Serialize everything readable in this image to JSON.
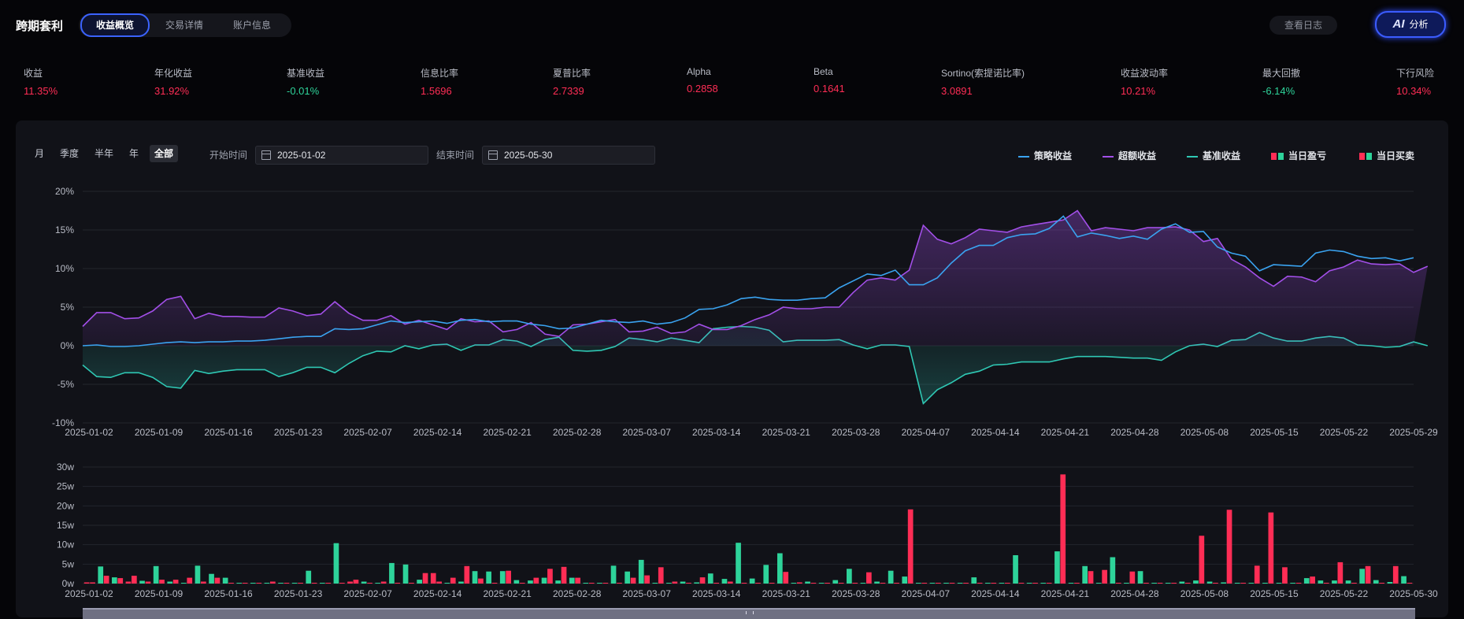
{
  "header": {
    "app_title": "跨期套利",
    "tabs": [
      "收益概览",
      "交易详情",
      "账户信息"
    ],
    "active_tab": 0,
    "log_button": "查看日志",
    "ai_button": {
      "mark": "AI",
      "label": "分析"
    }
  },
  "metrics": [
    {
      "label": "收益",
      "value": "11.35%",
      "color": "#ff2d55"
    },
    {
      "label": "年化收益",
      "value": "31.92%",
      "color": "#ff2d55"
    },
    {
      "label": "基准收益",
      "value": "-0.01%",
      "color": "#2ed39a"
    },
    {
      "label": "信息比率",
      "value": "1.5696",
      "color": "#ff2d55"
    },
    {
      "label": "夏普比率",
      "value": "2.7339",
      "color": "#ff2d55"
    },
    {
      "label": "Alpha",
      "value": "0.2858",
      "color": "#ff2d55"
    },
    {
      "label": "Beta",
      "value": "0.1641",
      "color": "#ff2d55"
    },
    {
      "label": "Sortino(索提诺比率)",
      "value": "3.0891",
      "color": "#ff2d55"
    },
    {
      "label": "收益波动率",
      "value": "10.21%",
      "color": "#ff2d55"
    },
    {
      "label": "最大回撤",
      "value": "-6.14%",
      "color": "#2ed39a"
    },
    {
      "label": "下行风险",
      "value": "10.34%",
      "color": "#ff2d55"
    }
  ],
  "controls": {
    "periods": [
      "月",
      "季度",
      "半年",
      "年",
      "全部"
    ],
    "active_period": 4,
    "start_label": "开始时间",
    "start_date": "2025-01-02",
    "end_label": "结束时间",
    "end_date": "2025-05-30"
  },
  "legend": [
    "策略收益",
    "超额收益",
    "基准收益",
    "当日盈亏",
    "当日买卖"
  ],
  "colors": {
    "strategy": "#3aa3f0",
    "excess": "#a24fe8",
    "benchmark": "#2fc8b4",
    "profit": "#ff2d55",
    "loss": "#2ed39a"
  },
  "chart_data": [
    {
      "type": "line",
      "ylim": [
        -10,
        20
      ],
      "yticks": [
        "20%",
        "15%",
        "10%",
        "5%",
        "0%",
        "-5%",
        "-10%"
      ],
      "xticks": [
        "2025-01-02",
        "2025-01-09",
        "2025-01-16",
        "2025-01-23",
        "2025-02-07",
        "2025-02-14",
        "2025-02-21",
        "2025-02-28",
        "2025-03-07",
        "2025-03-14",
        "2025-03-21",
        "2025-03-28",
        "2025-04-07",
        "2025-04-14",
        "2025-04-21",
        "2025-04-28",
        "2025-05-08",
        "2025-05-15",
        "2025-05-22",
        "2025-05-29"
      ],
      "series": [
        {
          "name": "策略收益",
          "values": [
            0.0,
            0.1,
            -0.1,
            -0.1,
            0.0,
            0.2,
            0.4,
            0.5,
            0.4,
            0.5,
            0.5,
            0.6,
            0.6,
            0.7,
            0.9,
            1.1,
            1.2,
            1.2,
            2.2,
            2.1,
            2.2,
            2.7,
            3.2,
            3.0,
            3.1,
            3.2,
            2.9,
            3.3,
            3.4,
            3.1,
            3.2,
            3.2,
            2.8,
            2.6,
            2.2,
            2.3,
            2.8,
            3.3,
            3.1,
            3.0,
            3.2,
            2.8,
            3.0,
            3.6,
            4.7,
            4.8,
            5.3,
            6.1,
            6.3,
            6.0,
            5.9,
            5.9,
            6.1,
            6.2,
            7.5,
            8.4,
            9.3,
            9.1,
            9.8,
            7.9,
            7.9,
            8.8,
            10.7,
            12.3,
            13.0,
            13.0,
            14.0,
            14.4,
            14.5,
            15.2,
            16.8,
            14.1,
            14.6,
            14.3,
            13.9,
            14.2,
            13.8,
            15.1,
            15.8,
            14.7,
            14.8,
            12.8,
            12.0,
            11.6,
            9.7,
            10.5,
            10.4,
            10.3,
            12.0,
            12.4,
            12.2,
            11.6,
            11.3,
            11.4,
            11.0,
            11.4
          ]
        },
        {
          "name": "超额收益",
          "values": [
            2.5,
            4.3,
            4.3,
            3.5,
            3.6,
            4.5,
            6.0,
            6.4,
            3.5,
            4.2,
            3.8,
            3.8,
            3.7,
            3.7,
            4.9,
            4.5,
            3.9,
            4.1,
            5.7,
            4.2,
            3.3,
            3.3,
            3.9,
            2.8,
            3.3,
            2.7,
            2.1,
            3.5,
            3.1,
            3.2,
            1.8,
            2.1,
            3.0,
            1.5,
            1.2,
            2.7,
            2.8,
            3.1,
            3.4,
            1.8,
            1.9,
            2.4,
            1.6,
            1.8,
            2.8,
            2.1,
            2.1,
            2.6,
            3.4,
            4.0,
            5.0,
            4.8,
            4.8,
            5.0,
            5.0,
            6.9,
            8.5,
            8.8,
            8.5,
            9.8,
            15.6,
            13.8,
            13.2,
            14.0,
            15.1,
            14.9,
            14.7,
            15.4,
            15.7,
            16.0,
            16.3,
            17.5,
            14.9,
            15.3,
            15.1,
            14.9,
            15.3,
            15.3,
            15.4,
            15.0,
            13.5,
            13.9,
            11.2,
            10.2,
            8.8,
            7.7,
            9.0,
            8.9,
            8.3,
            9.7,
            10.2,
            11.1,
            10.6,
            10.5,
            10.6,
            9.5,
            10.3
          ]
        },
        {
          "name": "基准收益",
          "values": [
            -2.5,
            -4.0,
            -4.1,
            -3.5,
            -3.5,
            -4.1,
            -5.3,
            -5.5,
            -3.2,
            -3.6,
            -3.3,
            -3.1,
            -3.1,
            -3.1,
            -4.0,
            -3.5,
            -2.8,
            -2.8,
            -3.5,
            -2.3,
            -1.3,
            -0.7,
            -0.8,
            0.0,
            -0.4,
            0.1,
            0.2,
            -0.6,
            0.1,
            0.1,
            0.8,
            0.6,
            -0.1,
            0.8,
            1.1,
            -0.6,
            -0.7,
            -0.6,
            -0.1,
            1.0,
            0.8,
            0.5,
            1.0,
            0.7,
            0.4,
            2.2,
            2.4,
            2.5,
            2.4,
            2.0,
            0.5,
            0.7,
            0.7,
            0.7,
            0.8,
            0.1,
            -0.4,
            0.1,
            0.1,
            -0.1,
            -7.5,
            -5.7,
            -4.8,
            -3.7,
            -3.3,
            -2.5,
            -2.4,
            -2.1,
            -2.1,
            -2.1,
            -1.7,
            -1.4,
            -1.4,
            -1.4,
            -1.5,
            -1.6,
            -1.6,
            -1.9,
            -0.8,
            0.0,
            0.2,
            -0.1,
            0.7,
            0.8,
            1.7,
            1.0,
            0.6,
            0.6,
            1.0,
            1.2,
            1.0,
            0.1,
            0.0,
            -0.2,
            -0.1,
            0.5,
            0.0
          ]
        }
      ]
    },
    {
      "type": "bar",
      "ylim": [
        0,
        30
      ],
      "yticks": [
        "30w",
        "25w",
        "20w",
        "15w",
        "10w",
        "5w",
        "0w"
      ],
      "xticks": [
        "2025-01-02",
        "2025-01-09",
        "2025-01-16",
        "2025-01-23",
        "2025-02-07",
        "2025-02-14",
        "2025-02-21",
        "2025-02-28",
        "2025-03-07",
        "2025-03-14",
        "2025-03-21",
        "2025-03-28",
        "2025-04-07",
        "2025-04-14",
        "2025-04-21",
        "2025-04-28",
        "2025-05-08",
        "2025-05-15",
        "2025-05-22",
        "2025-05-30"
      ],
      "series": [
        {
          "name": "当日盈亏",
          "values": [
            0.3,
            4.4,
            1.6,
            0.5,
            0.7,
            4.5,
            0.5,
            0.2,
            4.6,
            2.5,
            1.5,
            0.2,
            0.2,
            0.2,
            0.2,
            0.2,
            3.3,
            0.2,
            10.4,
            0.5,
            0.5,
            0.2,
            5.3,
            4.9,
            1.0,
            2.7,
            0.2,
            0.5,
            3.2,
            3.1,
            3.2,
            0.9,
            0.8,
            1.5,
            0.8,
            1.5,
            0.2,
            0.2,
            4.6,
            3.1,
            6.1,
            0.2,
            0.2,
            0.5,
            0.3,
            2.6,
            1.2,
            10.5,
            1.3,
            4.8,
            7.8,
            0.2,
            0.5,
            0.2,
            0.9,
            3.8,
            0.2,
            0.5,
            3.3,
            1.8,
            0.2,
            0.2,
            0.2,
            0.2,
            1.6,
            0.2,
            0.2,
            7.3,
            0.2,
            0.2,
            8.3,
            0.2,
            4.5,
            0.2,
            6.8,
            0.2,
            3.2,
            0.2,
            0.2,
            0.5,
            0.8,
            0.5,
            0.3,
            0.2,
            0.2,
            0.2,
            0.2,
            0.2,
            1.4,
            0.8,
            0.8,
            0.8,
            3.8,
            0.9,
            0.4,
            1.9
          ],
          "colors": [
            1,
            0,
            0,
            1,
            0,
            0,
            0,
            0,
            0,
            0,
            0,
            0,
            0,
            0,
            0,
            0,
            0,
            0,
            0,
            1,
            0,
            0,
            0,
            0,
            0,
            1,
            0,
            0,
            0,
            0,
            0,
            0,
            0,
            0,
            0,
            0,
            0,
            0,
            0,
            0,
            0,
            0,
            0,
            0,
            0,
            0,
            0,
            0,
            0,
            0,
            0,
            0,
            0,
            0,
            0,
            0,
            0,
            0,
            0,
            0,
            0,
            0,
            0,
            0,
            0,
            0,
            0,
            0,
            0,
            0,
            0,
            0,
            0,
            0,
            0,
            0,
            0,
            0,
            0,
            0,
            0,
            0,
            0,
            0,
            0,
            0,
            0,
            0,
            0,
            0,
            0,
            0,
            0,
            0,
            0,
            0
          ]
        },
        {
          "name": "当日买卖",
          "values": [
            0.3,
            2.0,
            1.4,
            2.0,
            0.5,
            1.0,
            1.0,
            1.5,
            0.5,
            1.5,
            0.2,
            0.2,
            0.2,
            0.5,
            0.2,
            0.2,
            0.2,
            0.2,
            0.2,
            1.0,
            0.2,
            0.5,
            0.2,
            0.2,
            2.7,
            0.5,
            1.5,
            4.5,
            1.3,
            0.2,
            3.3,
            0.2,
            1.5,
            3.8,
            4.3,
            1.5,
            0.2,
            0.2,
            0.2,
            1.5,
            2.1,
            4.2,
            0.5,
            0.2,
            1.6,
            0.2,
            0.5,
            0.2,
            0.2,
            0.2,
            3.0,
            0.3,
            0.2,
            0.2,
            0.2,
            0.2,
            2.9,
            0.2,
            0.2,
            19.1,
            0.2,
            0.2,
            0.2,
            0.2,
            0.2,
            0.2,
            0.2,
            0.2,
            0.2,
            0.2,
            28.1,
            0.2,
            3.2,
            3.5,
            0.2,
            3.1,
            0.2,
            0.2,
            0.2,
            0.2,
            12.3,
            0.2,
            19.0,
            0.2,
            4.6,
            18.3,
            4.2,
            0.2,
            1.8,
            0.2,
            5.5,
            0.2,
            4.5,
            0.2,
            4.5,
            0.2
          ]
        }
      ]
    }
  ]
}
